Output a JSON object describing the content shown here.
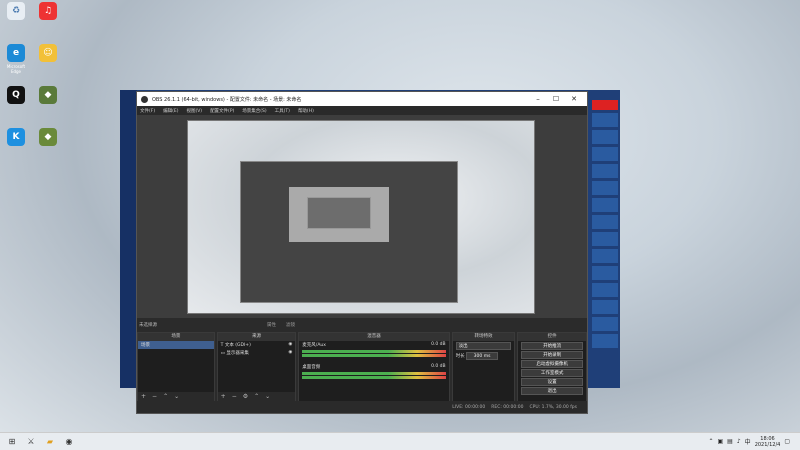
{
  "desktop": {
    "icons": [
      {
        "label": "",
        "color": "#e8eef4",
        "glyph": "♻"
      },
      {
        "label": "",
        "color": "#e33",
        "glyph": "♫"
      },
      {
        "label": "Microsoft Edge",
        "color": "#1c8ad6",
        "glyph": "e"
      },
      {
        "label": "",
        "color": "#f2c038",
        "glyph": "☺"
      },
      {
        "label": "",
        "color": "#111",
        "glyph": "Q"
      },
      {
        "label": "",
        "color": "#5a7a3a",
        "glyph": "◆"
      },
      {
        "label": "",
        "color": "#1e90e0",
        "glyph": "K"
      },
      {
        "label": "",
        "color": "#6a8a3a",
        "glyph": "◆"
      }
    ]
  },
  "bg_window": {
    "top_badge": "",
    "tiles": [
      "",
      "",
      "",
      "",
      "",
      "",
      "",
      "",
      "",
      "",
      "",
      "",
      "",
      ""
    ]
  },
  "obs": {
    "title": "OBS 26.1.1 (64-bit, windows) - 配置文件: 未命名 - 场景: 未命名",
    "menu": [
      "文件(F)",
      "编辑(E)",
      "视图(V)",
      "配置文件(P)",
      "场景集合(S)",
      "工具(T)",
      "帮助(H)"
    ],
    "status_left": "未选择源",
    "status_btn1": "属性",
    "status_btn2": "滤镜",
    "docks": {
      "scenes": {
        "header": "场景",
        "items": [
          "场景"
        ]
      },
      "sources": {
        "header": "来源",
        "items": [
          "文本 (GDI+)",
          "显示器采集"
        ]
      },
      "mixer": {
        "header": "混音器",
        "tracks": [
          {
            "name": "麦克风/Aux",
            "db": "0.0 dB"
          },
          {
            "name": "桌面音频",
            "db": "0.0 dB"
          }
        ]
      },
      "transitions": {
        "header": "转场特效",
        "type": "淡出",
        "duration_label": "时长",
        "duration": "300 ms"
      },
      "controls": {
        "header": "控件",
        "buttons": [
          "开始推流",
          "开始录制",
          "启动虚拟摄像机",
          "工作室模式",
          "设置",
          "退出"
        ]
      }
    },
    "bottom": {
      "live": "LIVE: 00:00:00",
      "rec": "REC: 00:00:00",
      "cpu": "CPU: 1.7%, 30.00 fps"
    }
  },
  "taskbar": {
    "time": "18:06",
    "date": "2021/12/4"
  }
}
